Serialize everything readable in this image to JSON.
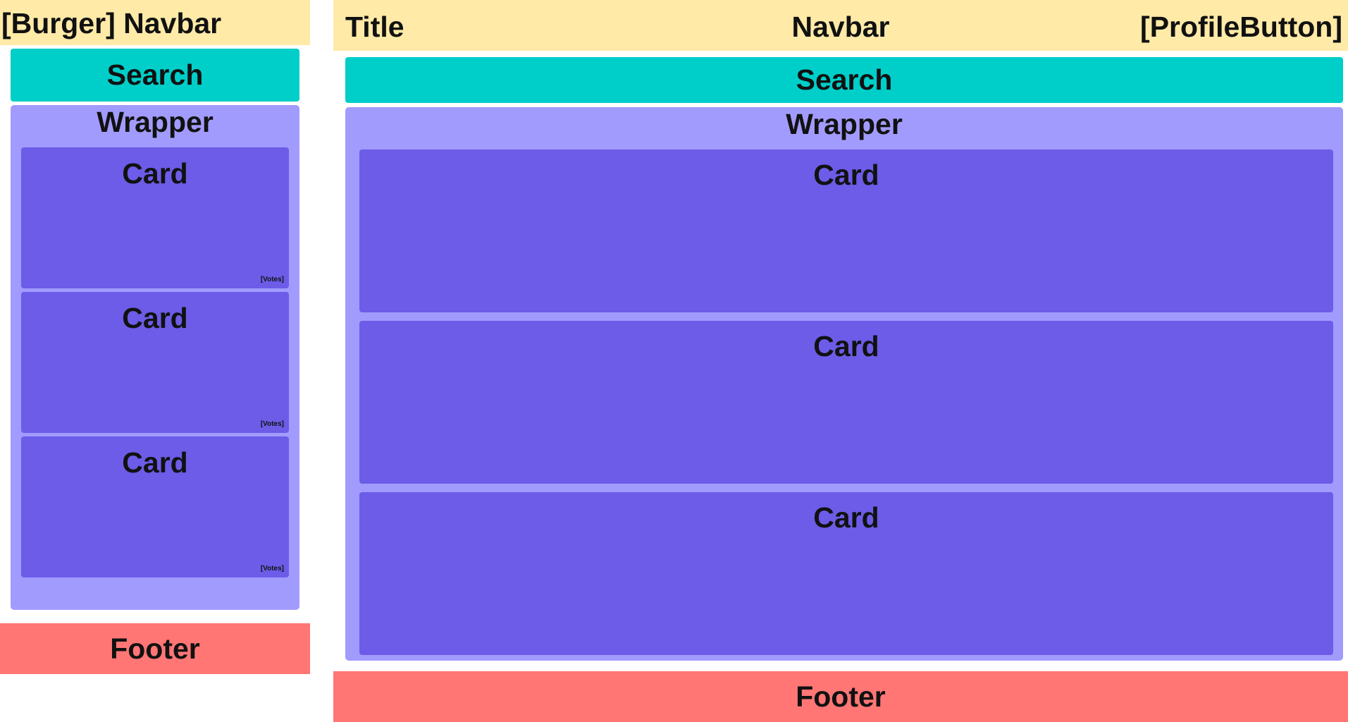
{
  "mobile": {
    "navbar": "[Burger] Navbar",
    "search": "Search",
    "wrapper": "Wrapper",
    "cards": [
      {
        "title": "Card",
        "votes": "[Votes]"
      },
      {
        "title": "Card",
        "votes": "[Votes]"
      },
      {
        "title": "Card",
        "votes": "[Votes]"
      }
    ],
    "footer": "Footer"
  },
  "desktop": {
    "navbar": {
      "title": "Title",
      "center": "Navbar",
      "profile": "[ProfileButton]"
    },
    "search": "Search",
    "wrapper": "Wrapper",
    "cards": [
      {
        "title": "Card"
      },
      {
        "title": "Card"
      },
      {
        "title": "Card"
      }
    ],
    "footer": "Footer"
  },
  "colors": {
    "navbar": "#ffeaa7",
    "search": "#00cec9",
    "wrapper": "#a29bfe",
    "card": "#6c5ce7",
    "footer": "#ff7675"
  }
}
